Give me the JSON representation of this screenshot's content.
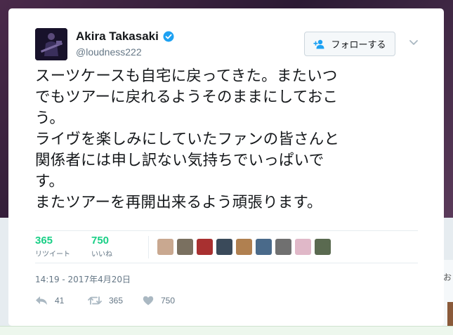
{
  "user": {
    "display_name": "Akira Takasaki",
    "handle": "@loudness222"
  },
  "follow": {
    "label": "フォローする"
  },
  "tweet": {
    "lines": [
      "スーツケースも自宅に戻ってきた。またいつ",
      "でもツアーに戻れるようそのままにしておこ",
      "う。",
      "ライヴを楽しみにしていたファンの皆さんと",
      "関係者には申し訳ない気持ちでいっぱいで",
      "す。",
      "またツアーを再開出来るよう頑張ります。"
    ]
  },
  "stats": {
    "retweets": {
      "count": "365",
      "label": "リツイート"
    },
    "likes": {
      "count": "750",
      "label": "いいね"
    }
  },
  "timestamp": "14:19 - 2017年4月20日",
  "actions": {
    "reply_count": "41",
    "retweet_count": "365",
    "like_count": "750"
  },
  "background": {
    "right_fragment": "お"
  },
  "colors": {
    "stat_green": "#19cf86",
    "verified_blue": "#1da1f2",
    "icon_gray": "#aab8c2",
    "text_gray": "#657786"
  },
  "icons": [
    "verified-badge-icon",
    "add-user-icon",
    "chevron-down-icon",
    "reply-icon",
    "retweet-icon",
    "heart-icon"
  ],
  "liker_avatar_colors": [
    "#c9a890",
    "#7a7060",
    "#a83030",
    "#3a4a5a",
    "#b08050",
    "#4a6a8a",
    "#707070",
    "#e0b8c8",
    "#5a6a50"
  ]
}
